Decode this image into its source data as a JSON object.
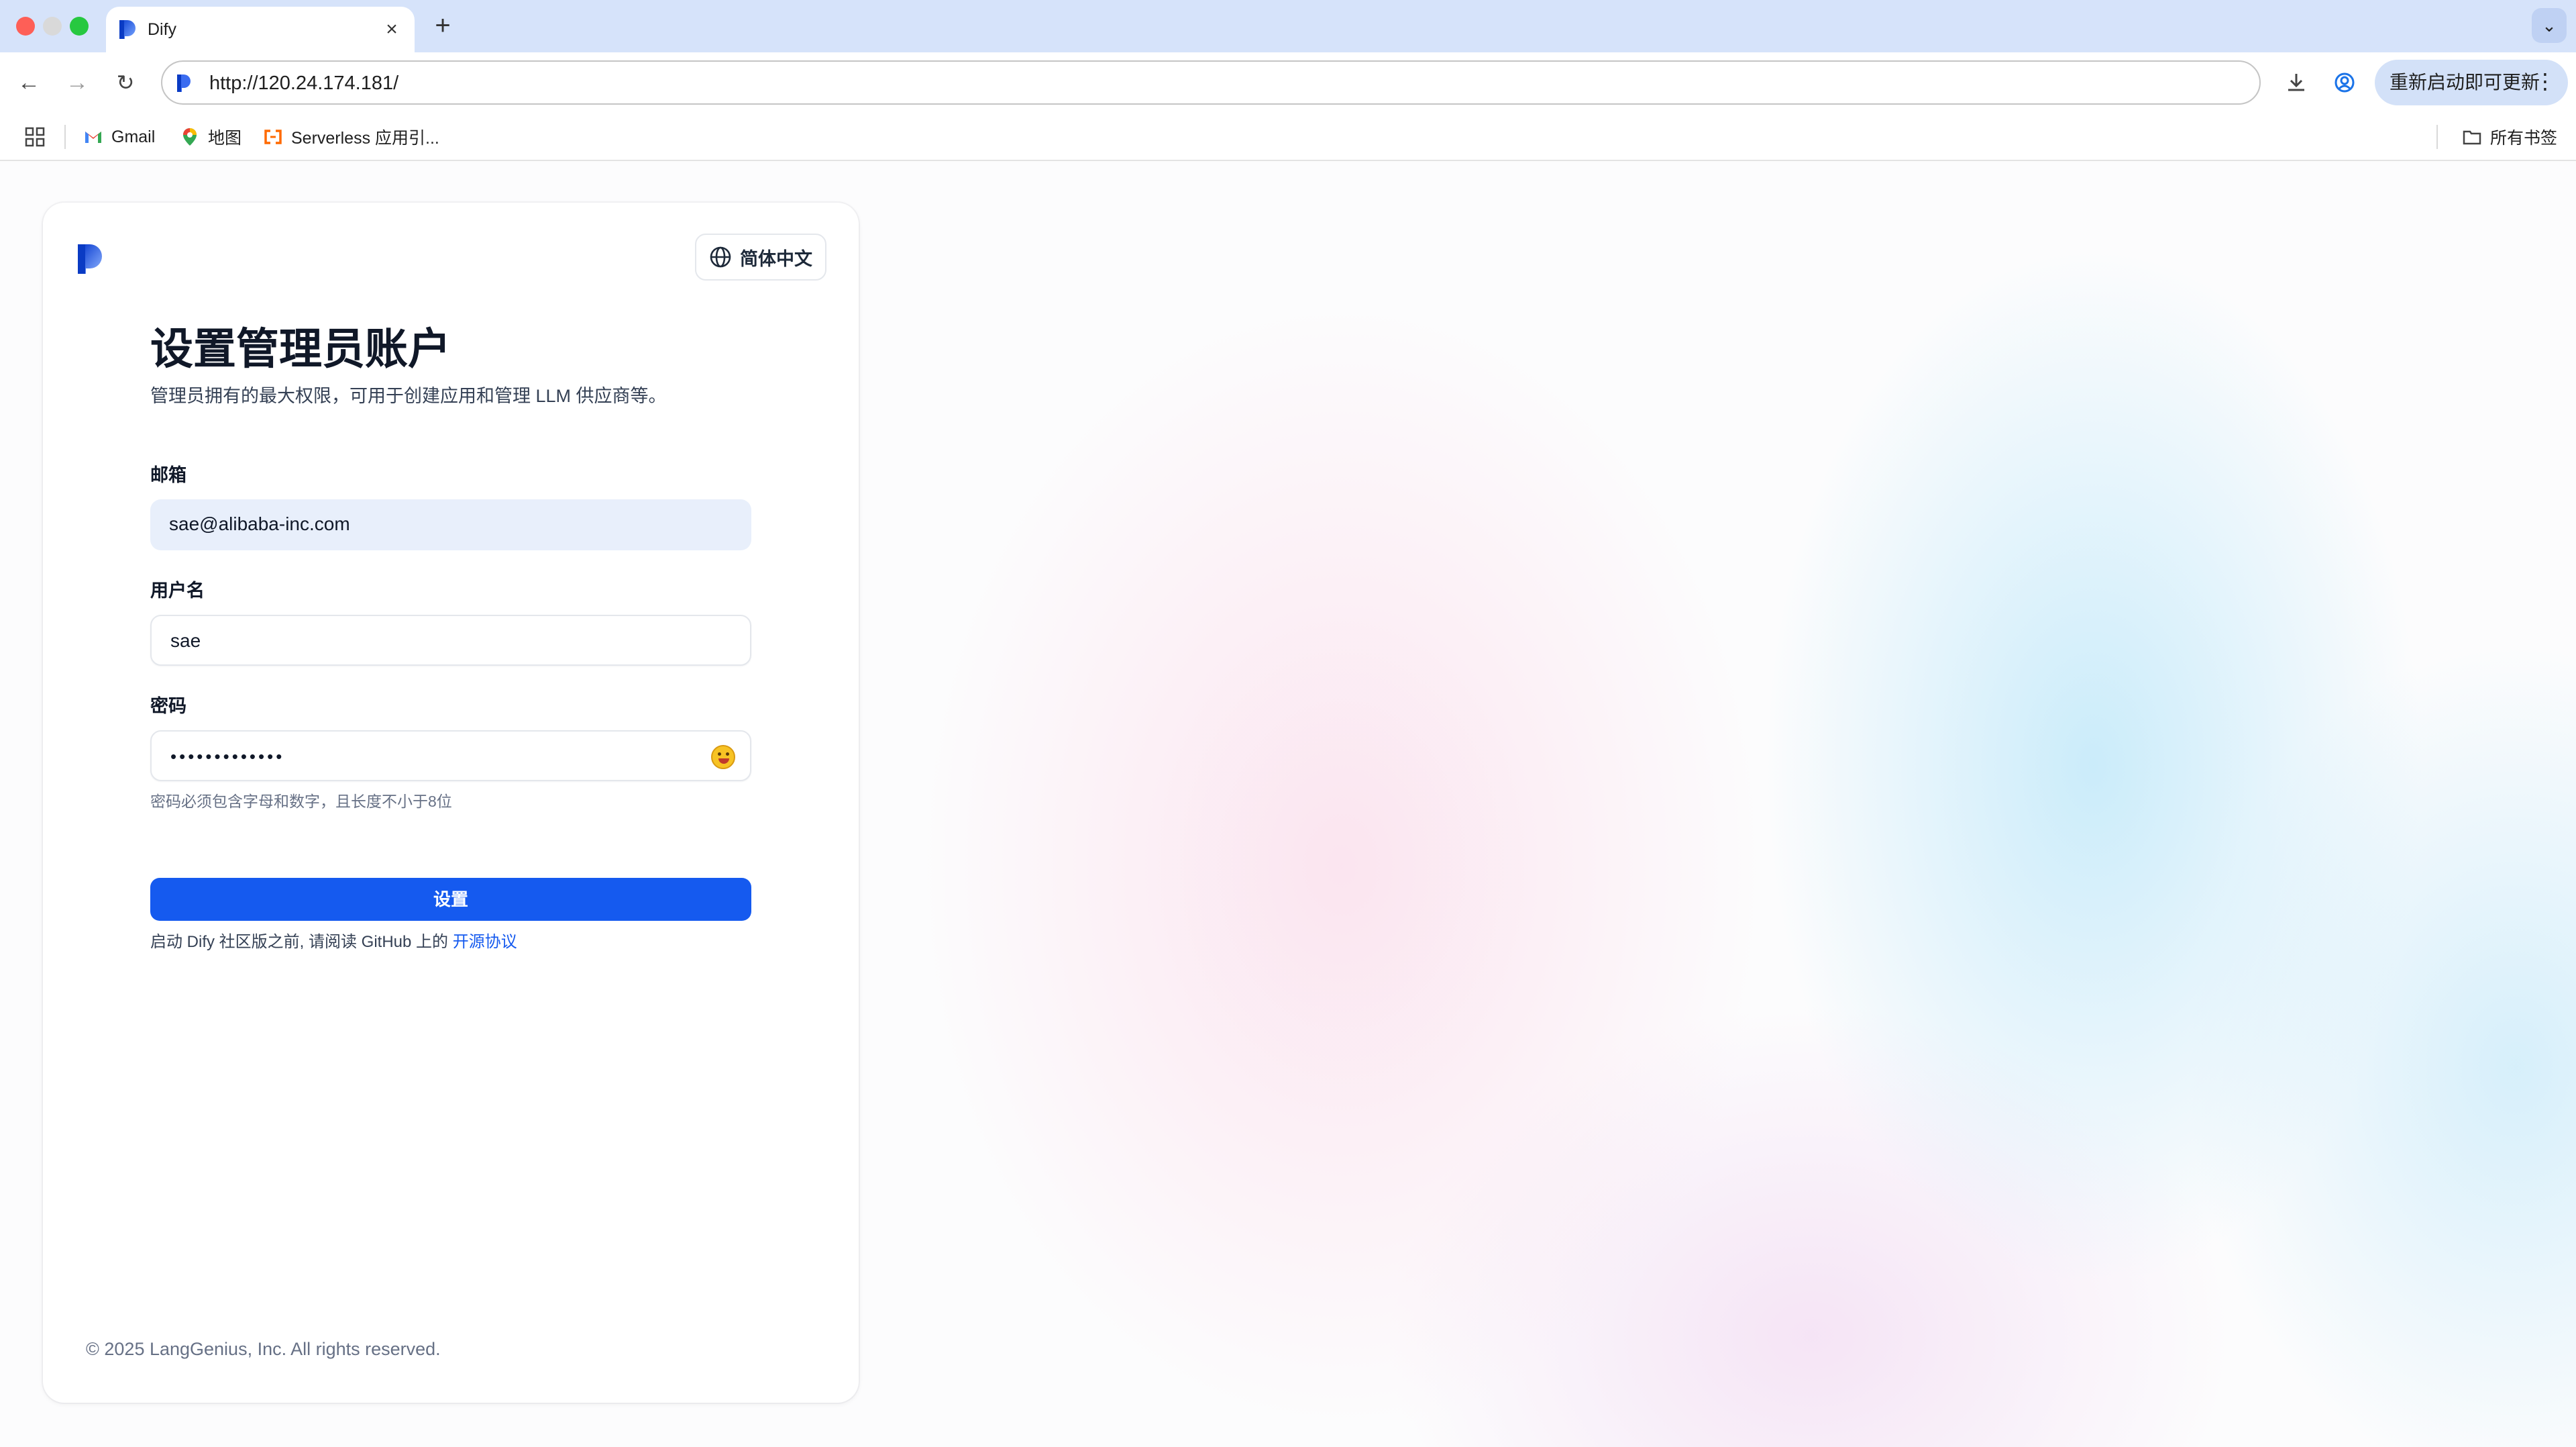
{
  "browser": {
    "tab_title": "Dify",
    "url": "http://120.24.174.181/",
    "update_button_label": "重新启动即可更新",
    "bookmarks": [
      {
        "label": "Gmail",
        "icon": "gmail-icon"
      },
      {
        "label": "地图",
        "icon": "maps-pin-icon"
      },
      {
        "label": "Serverless 应用引...",
        "icon": "serverless-icon"
      }
    ],
    "all_bookmarks_label": "所有书签"
  },
  "card": {
    "language_label": "简体中文",
    "title": "设置管理员账户",
    "subtitle": "管理员拥有的最大权限，可用于创建应用和管理 LLM 供应商等。",
    "fields": {
      "email_label": "邮箱",
      "email_value": "sae@alibaba-inc.com",
      "username_label": "用户名",
      "username_value": "sae",
      "password_label": "密码",
      "password_value": "•••••••••••••",
      "password_hint": "密码必须包含字母和数字，且长度不小于8位"
    },
    "submit_label": "设置",
    "agreement_prefix": "启动 Dify 社区版之前, 请阅读 GitHub 上的 ",
    "agreement_link": "开源协议",
    "footer": "© 2025 LangGenius, Inc. All rights reserved."
  },
  "colors": {
    "primary": "#155aef",
    "tabstrip": "#d6e3fa",
    "email_fill": "#e8effb"
  }
}
